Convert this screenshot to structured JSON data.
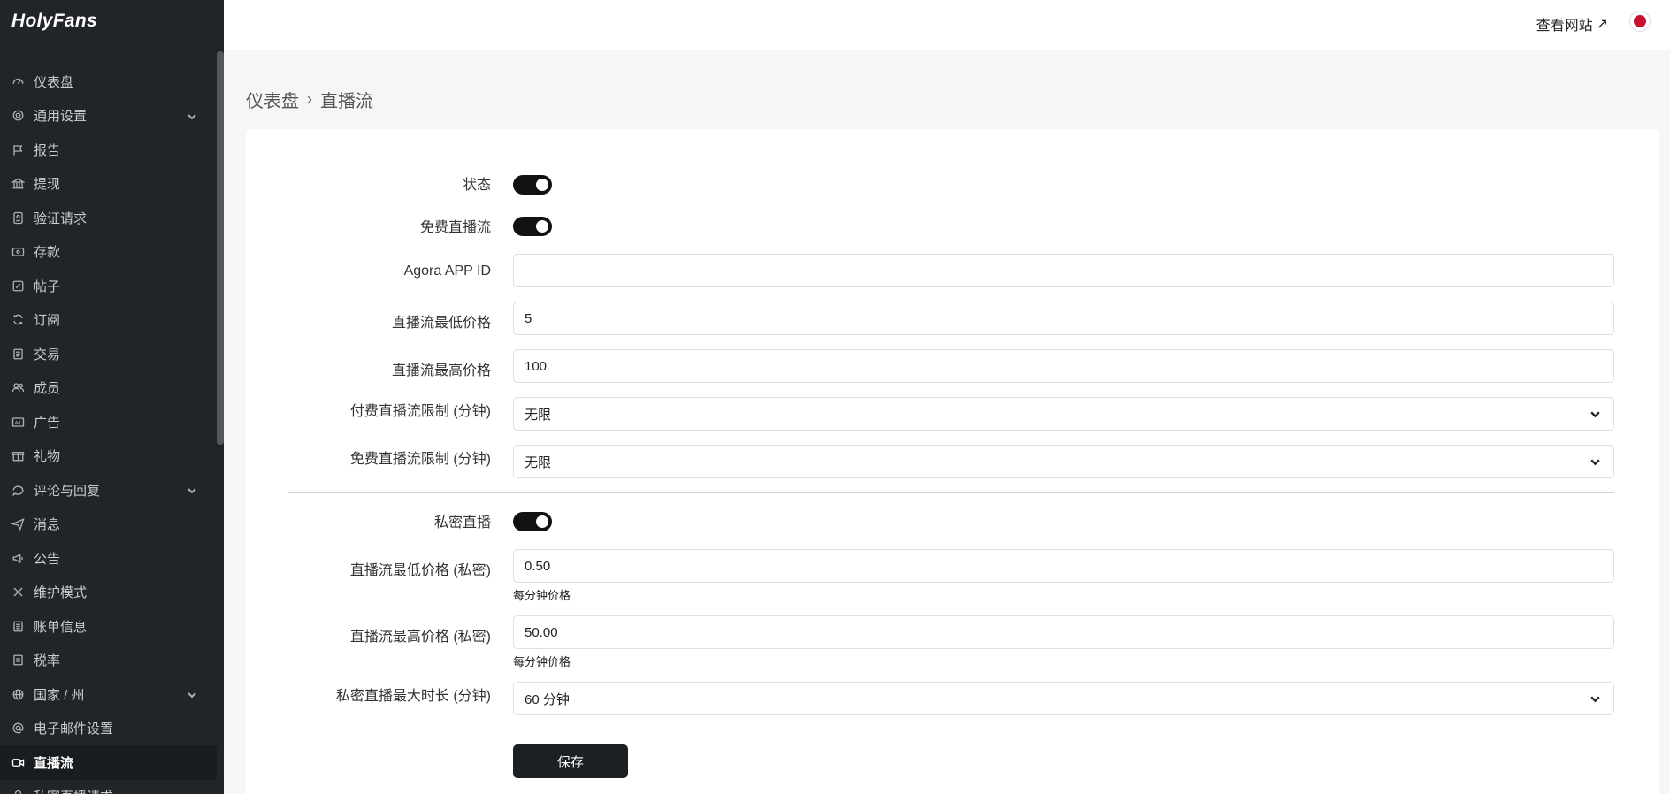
{
  "brand": "HolyFans",
  "sidebar": {
    "items": [
      {
        "label": "仪表盘",
        "icon": "dashboard-icon"
      },
      {
        "label": "通用设置",
        "icon": "gear-icon",
        "expand": true
      },
      {
        "label": "报告",
        "icon": "flag-icon"
      },
      {
        "label": "提现",
        "icon": "bank-icon"
      },
      {
        "label": "验证请求",
        "icon": "id-badge-icon"
      },
      {
        "label": "存款",
        "icon": "wallet-icon"
      },
      {
        "label": "帖子",
        "icon": "edit-icon"
      },
      {
        "label": "订阅",
        "icon": "refresh-icon"
      },
      {
        "label": "交易",
        "icon": "receipt-icon"
      },
      {
        "label": "成员",
        "icon": "users-icon"
      },
      {
        "label": "广告",
        "icon": "ad-icon"
      },
      {
        "label": "礼物",
        "icon": "gift-icon"
      },
      {
        "label": "评论与回复",
        "icon": "chat-icon",
        "expand": true
      },
      {
        "label": "消息",
        "icon": "send-icon"
      },
      {
        "label": "公告",
        "icon": "megaphone-icon"
      },
      {
        "label": "维护模式",
        "icon": "tools-icon"
      },
      {
        "label": "账单信息",
        "icon": "invoice-icon"
      },
      {
        "label": "税率",
        "icon": "tax-icon"
      },
      {
        "label": "国家 / 州",
        "icon": "globe-icon",
        "expand": true
      },
      {
        "label": "电子邮件设置",
        "icon": "at-icon"
      },
      {
        "label": "直播流",
        "icon": "camera-icon",
        "active": true
      },
      {
        "label": "私密直播请求",
        "icon": "lock-icon"
      }
    ]
  },
  "topbar": {
    "view_site": "查看网站",
    "view_site_arrow": "↗"
  },
  "breadcrumb": {
    "home": "仪表盘",
    "current": "直播流"
  },
  "form": {
    "status_label": "状态",
    "free_live_label": "免费直播流",
    "agora_label": "Agora APP ID",
    "agora_value": "",
    "min_price_label": "直播流最低价格",
    "min_price_value": "5",
    "max_price_label": "直播流最高价格",
    "max_price_value": "100",
    "paid_limit_label": "付费直播流限制 (分钟)",
    "paid_limit_value": "无限",
    "free_limit_label": "免费直播流限制 (分钟)",
    "free_limit_value": "无限",
    "private_label": "私密直播",
    "private_min_label": "直播流最低价格 (私密)",
    "private_min_value": "0.50",
    "private_min_hint": "每分钟价格",
    "private_max_label": "直播流最高价格 (私密)",
    "private_max_value": "50.00",
    "private_max_hint": "每分钟价格",
    "private_duration_label": "私密直播最大时长 (分钟)",
    "private_duration_value": "60 分钟",
    "save_label": "保存"
  }
}
